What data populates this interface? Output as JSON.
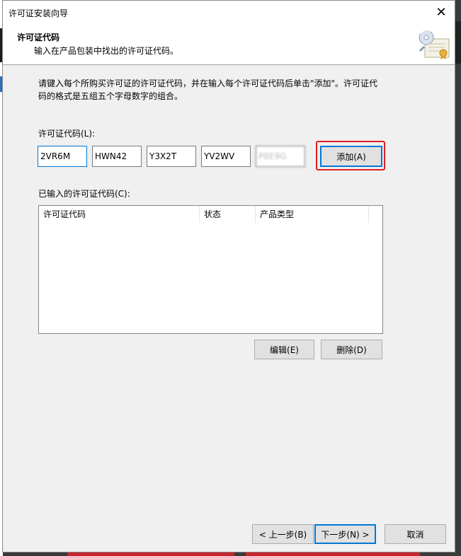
{
  "window": {
    "title": "许可证安装向导",
    "close_glyph": "✕"
  },
  "header": {
    "title": "许可证代码",
    "subtitle": "输入在产品包装中找出的许可证代码。",
    "icon": "certificate-disc-icon"
  },
  "instructions": {
    "line1": "请键入每个所购买许可证的许可证代码，并在输入每个许可证代码后单击\"添加\"。许可证代",
    "line2": "码的格式是五组五个字母数字的组合。"
  },
  "license_code": {
    "label": "许可证代码(L):",
    "segments": [
      "2VR6M",
      "HWN42",
      "Y3X2T",
      "YV2WV",
      "P8E9G"
    ]
  },
  "add_button": {
    "label": "添加(A)"
  },
  "entered_codes": {
    "label": "已输入的许可证代码(C):",
    "columns": [
      "许可证代码",
      "状态",
      "产品类型"
    ],
    "rows": []
  },
  "list_actions": {
    "edit_label": "编辑(E)",
    "delete_label": "删除(D)"
  },
  "footer": {
    "back_label": "< 上一步(B)",
    "next_label": "下一步(N) >",
    "cancel_label": "取消"
  },
  "colors": {
    "highlight": "#e01e1e",
    "focus": "#0078d7"
  }
}
